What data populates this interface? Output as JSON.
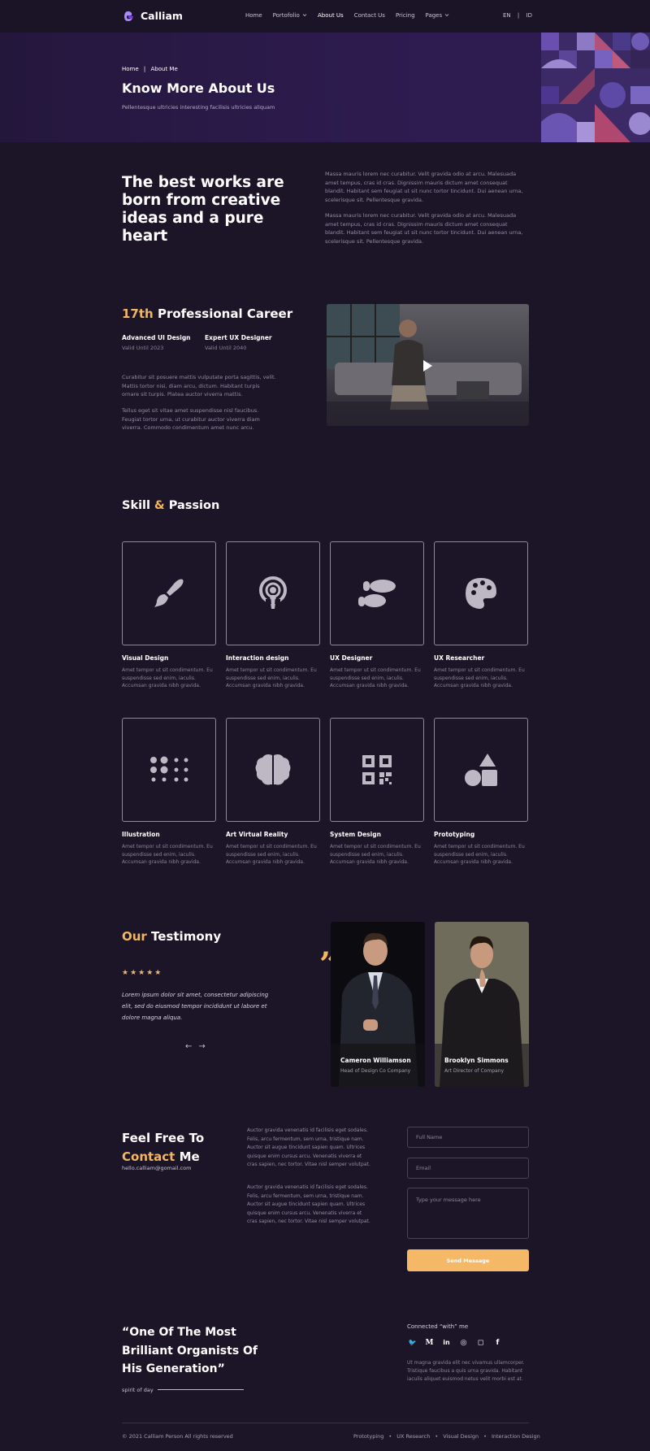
{
  "brand": {
    "name": "Calliam"
  },
  "nav": {
    "items": [
      {
        "label": "Home"
      },
      {
        "label": "Portofolio"
      },
      {
        "label": "About Us"
      },
      {
        "label": "Contact Us"
      },
      {
        "label": "Pricing"
      },
      {
        "label": "Pages"
      }
    ],
    "lang_en": "EN",
    "lang_sep": "|",
    "lang_id": "ID"
  },
  "hero": {
    "crumb_home": "Home",
    "crumb_sep": "|",
    "crumb_current": "About Me",
    "title": "Know More About Us",
    "subtitle": "Pellentesque ultricies interesting facilisis ultricies aliquam"
  },
  "intro": {
    "title": "The best works are born from creative ideas and a pure heart",
    "para1": "Massa mauris lorem nec curabitur. Velit gravida odio at arcu. Malesuada amet tempus, cras id cras. Dignissim mauris dictum amet consequat blandit. Habitant sem feugiat ut sit nunc tortor tincidunt. Dui aenean urna, scelerisque sit. Pellentesque gravida.",
    "para2": "Massa mauris lorem nec curabitur. Velit gravida odio at arcu. Malesuada amet tempus, cras id cras. Dignissim mauris dictum amet consequat blandit. Habitant sem feugiat ut sit nunc tortor tincidunt. Dui aenean urna, scelerisque sit. Pellentesque gravida."
  },
  "career": {
    "accent": "17th",
    "rest": " Professional Career",
    "cert1_title": "Advanced UI Design",
    "cert1_valid": "Valid Until 2023",
    "cert2_title": "Expert UX Designer",
    "cert2_valid": "Valid Until 2040",
    "para1": "Curabitur sit posuere mattis vulputate porta sagittis, velit. Mattis tortor nisi, diam arcu, dictum. Habitant turpis ornare sit turpis. Platea auctor viverra mattis.",
    "para2": "Tellus eget sit vitae amet suspendisse nisl faucibus. Feugiat tortor urna, ut curabitur auctor viverra diam viverra. Commodo condimentum amet nunc arcu."
  },
  "skills": {
    "title_a": "Skill",
    "title_amp": " & ",
    "title_b": "Passion",
    "desc": "Amet tempor ut sit condimentum. Eu suspendisse sed enim, iaculis. Accumsan gravida nibh gravida.",
    "items": [
      {
        "label": "Visual Design",
        "icon": "brush-icon"
      },
      {
        "label": "Interaction design",
        "icon": "podcast-icon"
      },
      {
        "label": "UX Designer",
        "icon": "footprints-icon"
      },
      {
        "label": "UX Researcher",
        "icon": "palette-icon"
      },
      {
        "label": "Illustration",
        "icon": "dots-grid-icon"
      },
      {
        "label": "Art Virtual Reality",
        "icon": "brain-icon"
      },
      {
        "label": "System Design",
        "icon": "qr-code-icon"
      },
      {
        "label": "Prototyping",
        "icon": "shapes-icon"
      }
    ]
  },
  "testimony": {
    "title_a": "Our",
    "title_b": " Testimony",
    "stars": "★★★★★",
    "quote": "Lorem ipsum dolor sit amet, consectetur adipiscing elit, sed do eiusmod tempor incididunt ut labore et dolore magna aliqua.",
    "prev": "←",
    "next": "→",
    "quote_mark": "”",
    "people": [
      {
        "name": "Cameron Williamson",
        "role": "Head of Design Co Company"
      },
      {
        "name": "Brooklyn Simmons",
        "role": "Art Director of Company"
      }
    ]
  },
  "contact": {
    "line1": "Feel Free To",
    "accent": "Contact",
    "line2_rest": " Me",
    "email": "hello.calliam@gomail.com",
    "para1": "Auctor gravida venenatis id facilisis eget sodales. Felis, arcu fermentum, sem urna, tristique nam. Auctor sit augue tincidunt sapien quam. Ultrices quisque enim cursus arcu. Venenatis viverra et cras sapien, nec tortor. Vitae nisl semper volutpat.",
    "para2": "Auctor gravida venenatis id facilisis eget sodales. Felis, arcu fermentum, sem urna, tristique nam. Auctor sit augue tincidunt sapien quam. Ultrices quisque enim cursus arcu. Venenatis viverra et cras sapien, nec tortor. Vitae nisl semper volutpat.",
    "full_name_placeholder": "Full Name",
    "email_placeholder": "Email",
    "message_placeholder": "Type your message here",
    "send_label": "Send Message"
  },
  "footer": {
    "quote": "“One Of The Most Brilliant Organists Of His Generation”",
    "quote_sub": "spirit of day",
    "connected": "Connected “with” me",
    "socials": [
      "twitter-icon",
      "medium-icon",
      "linkedin-icon",
      "dribbble-icon",
      "instagram-icon",
      "facebook-icon"
    ],
    "social_glyphs": {
      "twitter": "🐦",
      "medium": "M",
      "linkedin": "in",
      "dribbble": "◎",
      "instagram": "◻",
      "facebook": "f"
    },
    "desc": "Ut magna gravida elit nec vivamus ullamcorper. Tristique faucibus a quis urna gravida. Habitant iaculis aliquet euismod netus velit morbi est at.",
    "copyright": "© 2021 Calliam Person All rights reserved",
    "links": [
      {
        "label": "Prototyping"
      },
      {
        "label": "UX Research"
      },
      {
        "label": "Visual Design"
      },
      {
        "label": "Interaction Design"
      }
    ],
    "link_sep": "•"
  },
  "colors": {
    "accent": "#f2b661",
    "background": "#1c1528",
    "hero": "#2d1b4e",
    "brand_purple": "#8b5cf6"
  }
}
